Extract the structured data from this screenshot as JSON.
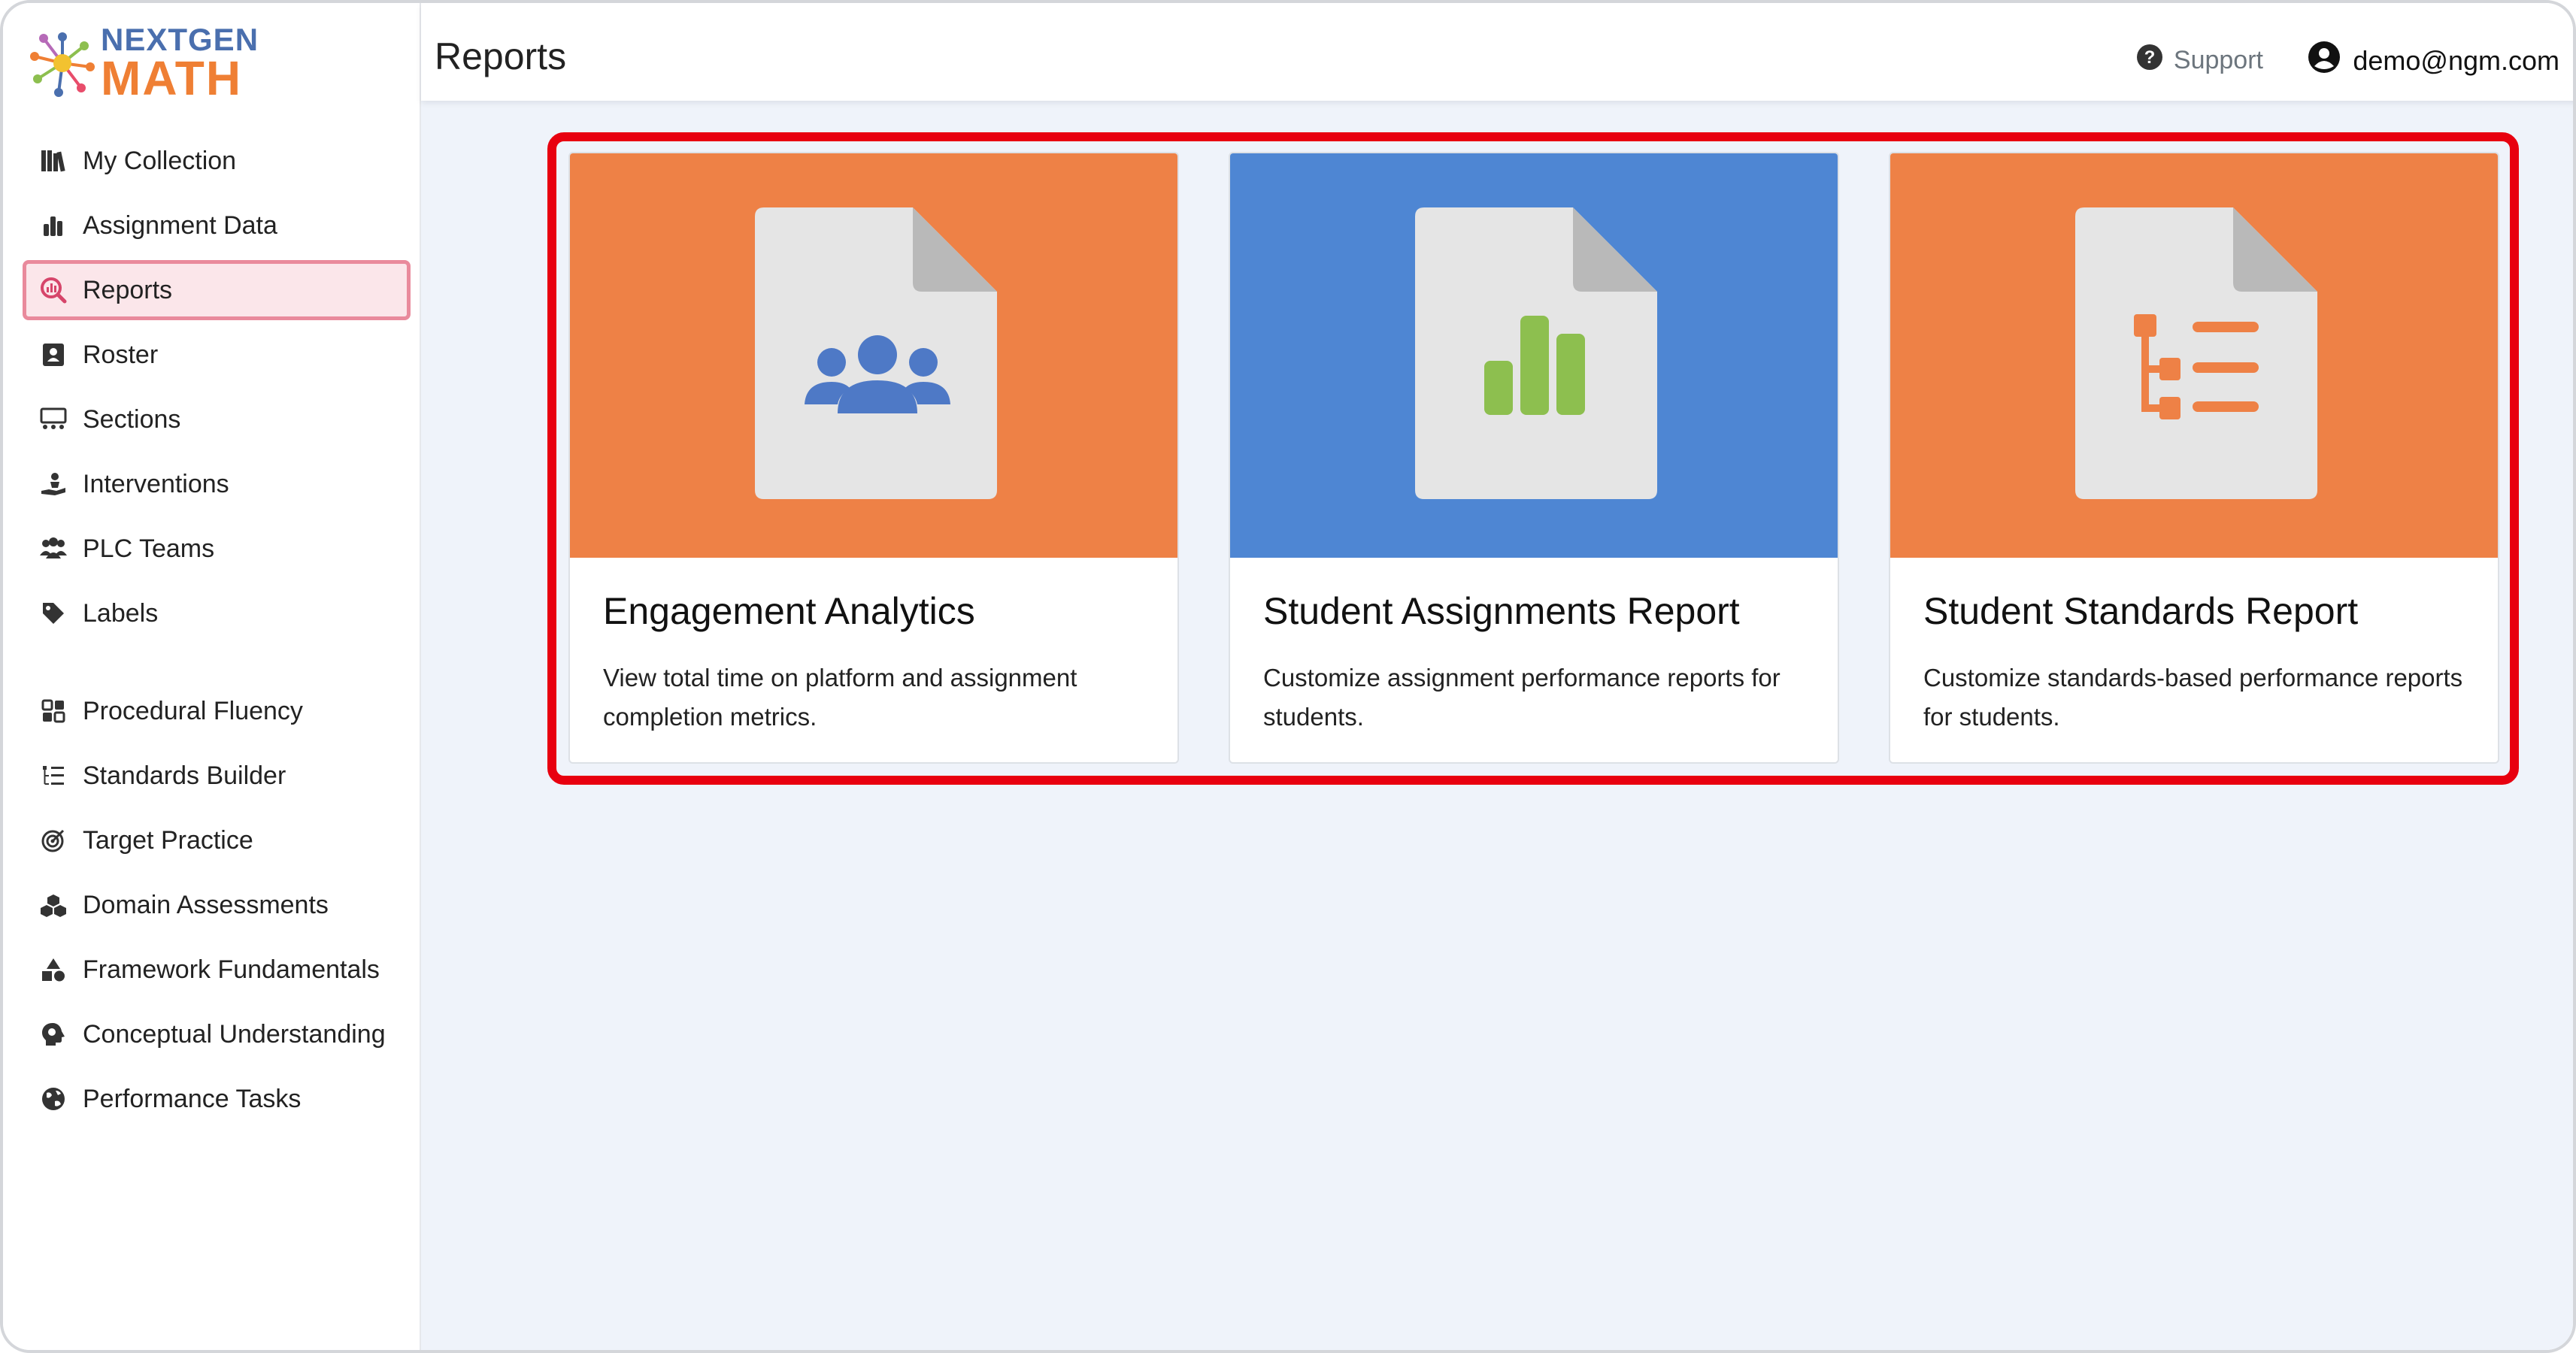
{
  "brand": {
    "line1": "NEXTGEN",
    "line2": "MATH"
  },
  "header": {
    "title": "Reports",
    "support_label": "Support",
    "user_email": "demo@ngm.com"
  },
  "sidebar": {
    "items": [
      {
        "label": "My Collection",
        "icon": "books-icon"
      },
      {
        "label": "Assignment Data",
        "icon": "bar-chart-icon"
      },
      {
        "label": "Reports",
        "icon": "magnifier-chart-icon",
        "active": true
      },
      {
        "label": "Roster",
        "icon": "id-badge-icon"
      },
      {
        "label": "Sections",
        "icon": "classroom-icon"
      },
      {
        "label": "Interventions",
        "icon": "hand-person-icon"
      },
      {
        "label": "PLC Teams",
        "icon": "people-group-icon"
      },
      {
        "label": "Labels",
        "icon": "tag-icon"
      }
    ],
    "programs": [
      {
        "label": "Procedural Fluency",
        "icon": "grid-icon"
      },
      {
        "label": "Standards Builder",
        "icon": "tree-list-icon"
      },
      {
        "label": "Target Practice",
        "icon": "target-icon"
      },
      {
        "label": "Domain Assessments",
        "icon": "cubes-icon"
      },
      {
        "label": "Framework Fundamentals",
        "icon": "shapes-icon"
      },
      {
        "label": "Conceptual Understanding",
        "icon": "head-brain-icon"
      },
      {
        "label": "Performance Tasks",
        "icon": "globe-icon"
      }
    ]
  },
  "cards": [
    {
      "title": "Engagement Analytics",
      "description": "View total time on platform and assignment completion metrics.",
      "color": "#ee8146",
      "icon": "users-group-icon",
      "icon_color": "#4e79c6"
    },
    {
      "title": "Student Assignments Report",
      "description": "Customize assignment performance reports for students.",
      "color": "#4e86d3",
      "icon": "bar-chart-icon",
      "icon_color": "#8dbf4f"
    },
    {
      "title": "Student Standards Report",
      "description": "Customize standards-based performance reports for students.",
      "color": "#ee8146",
      "icon": "tree-list-icon",
      "icon_color": "#ee8146"
    }
  ]
}
